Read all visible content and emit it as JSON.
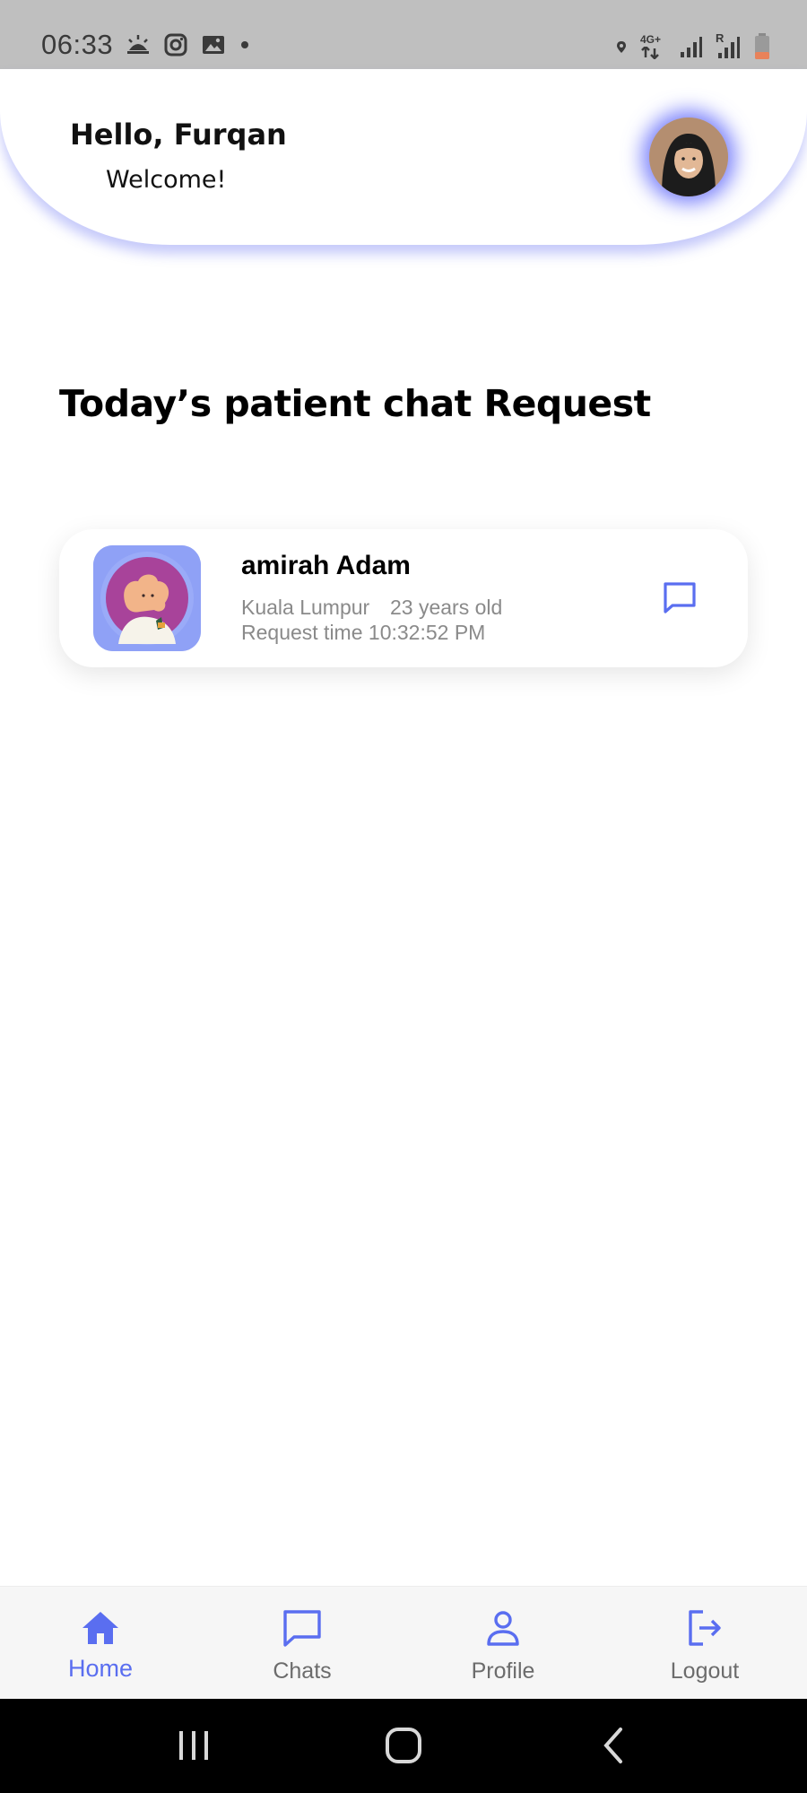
{
  "status_bar": {
    "time": "06:33",
    "icons_left": [
      "weather-sunrise-icon",
      "instagram-icon",
      "gallery-icon",
      "dot-icon"
    ],
    "icons_right": [
      "location-icon",
      "network-4g-icon",
      "signal-icon",
      "signal-roaming-icon",
      "battery-icon"
    ],
    "network_label": "4G+",
    "roaming_label": "R"
  },
  "header": {
    "greeting": "Hello, Furqan",
    "subtitle": "Welcome!"
  },
  "section": {
    "title": "Today’s patient chat Request"
  },
  "requests": [
    {
      "name": "amirah Adam",
      "location": "Kuala Lumpur",
      "age": "23 years old",
      "request_time": "Request time 10:32:52 PM"
    }
  ],
  "bottom_nav": {
    "items": [
      {
        "label": "Home",
        "icon": "home-icon",
        "active": true
      },
      {
        "label": "Chats",
        "icon": "chat-icon",
        "active": false
      },
      {
        "label": "Profile",
        "icon": "person-icon",
        "active": false
      },
      {
        "label": "Logout",
        "icon": "logout-icon",
        "active": false
      }
    ]
  },
  "colors": {
    "accent": "#5a6ef0",
    "status_bar_bg": "#bfbfbf",
    "nav_bg": "#f6f6f6",
    "muted_text": "#8a8a8a"
  }
}
